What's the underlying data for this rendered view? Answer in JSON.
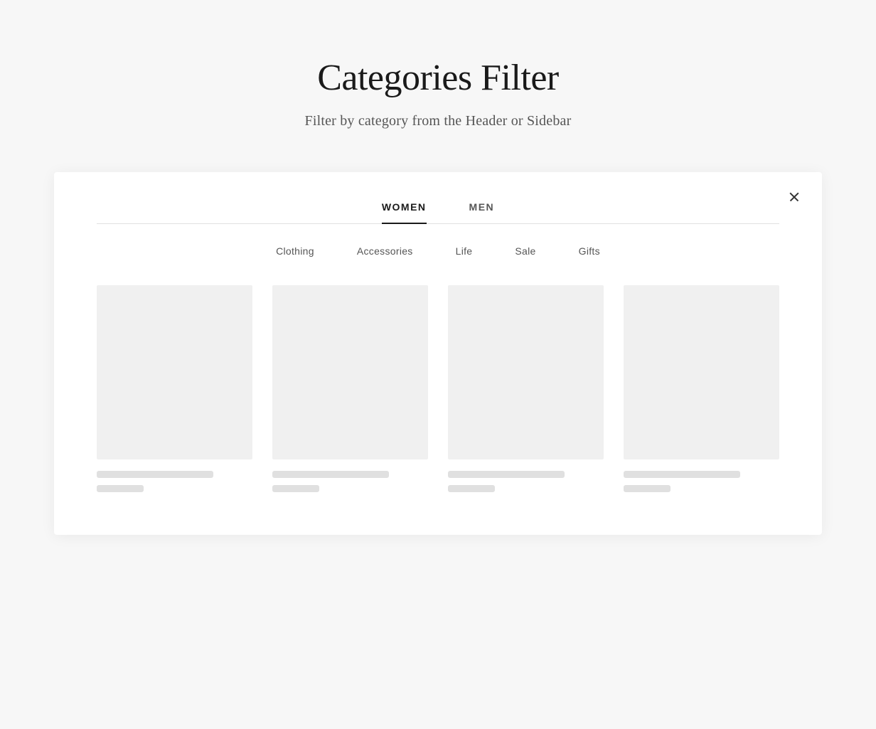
{
  "page": {
    "title": "Categories Filter",
    "subtitle": "Filter by category from the Header or Sidebar"
  },
  "modal": {
    "close_label": "×",
    "tabs": [
      {
        "label": "WOMEN",
        "active": true
      },
      {
        "label": "MEN",
        "active": false
      }
    ],
    "categories": [
      {
        "label": "Clothing"
      },
      {
        "label": "Accessories"
      },
      {
        "label": "Life"
      },
      {
        "label": "Sale"
      },
      {
        "label": "Gifts"
      }
    ],
    "products": [
      {
        "id": 1
      },
      {
        "id": 2
      },
      {
        "id": 3
      },
      {
        "id": 4
      }
    ]
  }
}
